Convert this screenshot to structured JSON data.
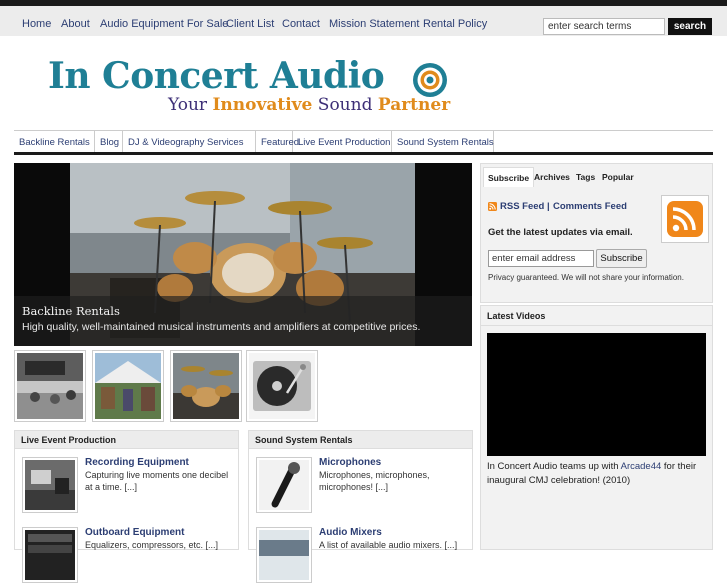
{
  "nav": {
    "items": [
      "Home",
      "About",
      "Audio Equipment For Sale",
      "Client List",
      "Contact",
      "Mission Statement",
      "Rental Policy"
    ],
    "search_placeholder": "enter search terms",
    "search_button": "search"
  },
  "logo": {
    "main": "In Concert Audio",
    "tagline_1": "Your",
    "tagline_2": "Innovative",
    "tagline_3": "Sound",
    "tagline_4": "Partner",
    "colors": {
      "teal": "#1f7f95",
      "orange": "#e08b1c",
      "purple": "#3d2f77"
    }
  },
  "categories": [
    "Backline Rentals",
    "Blog",
    "DJ & Videography Services",
    "Featured",
    "Live Event Production",
    "Sound System Rentals"
  ],
  "slider": {
    "title": "Backline Rentals",
    "description": "High quality, well-maintained musical instruments and amplifiers at competitive prices."
  },
  "thumbnails": [
    "event-crowd-photo",
    "outdoor-tent-photo",
    "drum-kit-photo",
    "turntable-photo"
  ],
  "sections": [
    {
      "heading": "Live Event Production",
      "posts": [
        {
          "title": "Recording Equipment",
          "excerpt": "Capturing live moments one decibel at a time. [...]"
        },
        {
          "title": "Outboard Equipment",
          "excerpt": "Equalizers, compressors, etc. [...]"
        }
      ]
    },
    {
      "heading": "Sound System Rentals",
      "posts": [
        {
          "title": "Microphones",
          "excerpt": "Microphones, microphones, microphones! [...]"
        },
        {
          "title": "Audio Mixers",
          "excerpt": "A list of available audio mixers. [...]"
        }
      ]
    }
  ],
  "sidebar": {
    "tabs": [
      "Subscribe",
      "Archives",
      "Tags",
      "Popular"
    ],
    "rss_feed": "RSS Feed",
    "separator": "|",
    "comments_feed": "Comments Feed",
    "email_heading": "Get the latest updates via email.",
    "email_value": "enter email address",
    "subscribe_button": "Subscribe",
    "privacy": "Privacy guaranteed. We will not share your information."
  },
  "videos": {
    "heading": "Latest Videos",
    "caption_pre": "In Concert Audio teams up with ",
    "caption_link": "Arcade44",
    "caption_post": " for their inaugural CMJ celebration! (2010)"
  }
}
